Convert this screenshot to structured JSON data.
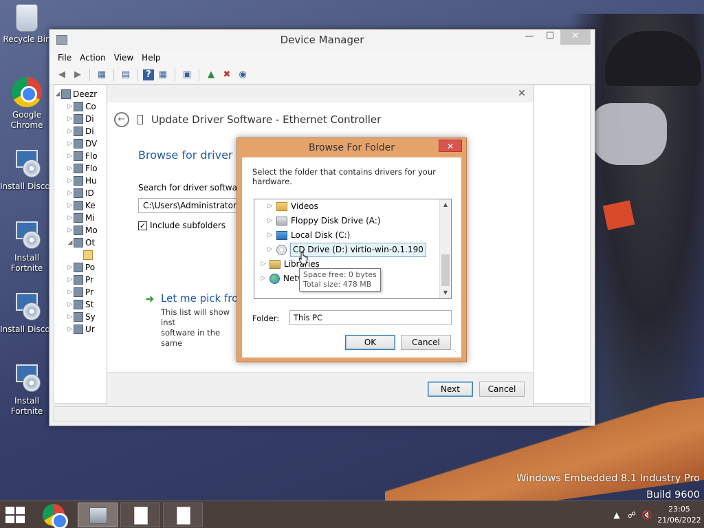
{
  "desktop": {
    "icons": [
      {
        "label": "Recycle Bin"
      },
      {
        "label": "Google Chrome"
      },
      {
        "label": "Install Discord"
      },
      {
        "label": "Install Fortnite"
      },
      {
        "label": "Install Discord"
      },
      {
        "label": "Install Fortnite"
      }
    ],
    "watermark": {
      "line1": "Windows Embedded 8.1 Industry Pro",
      "line2": "Build 9600"
    }
  },
  "device_manager": {
    "title": "Device Manager",
    "menu": [
      "File",
      "Action",
      "View",
      "Help"
    ],
    "tree": {
      "root": "Deezr",
      "items": [
        "Co",
        "Di",
        "Di",
        "DV",
        "Flo",
        "Flo",
        "Hu",
        "ID",
        "Ke",
        "Mi",
        "Mo",
        "Ot",
        "",
        "Po",
        "Pr",
        "Pr",
        "St",
        "Sy",
        "Ur"
      ]
    }
  },
  "wizard": {
    "header": "Update Driver Software - Ethernet Controller",
    "heading": "Browse for driver sof",
    "search_label": "Search for driver software in",
    "path_value": "C:\\Users\\Administrator\\Do",
    "include_subfolders": "Include subfolders",
    "pick_title": "Let me pick from",
    "pick_desc_1": "This list will show inst",
    "pick_desc_2": "software in the same",
    "next": "Next",
    "cancel": "Cancel"
  },
  "browse_dialog": {
    "title": "Browse For Folder",
    "description": "Select the folder that contains drivers for your hardware.",
    "tree": [
      {
        "label": "Videos",
        "icon": "folder-icon"
      },
      {
        "label": "Floppy Disk Drive (A:)",
        "icon": "floppy-drive-icon"
      },
      {
        "label": "Local Disk (C:)",
        "icon": "local-disk-icon"
      },
      {
        "label": "CD Drive (D:) virtio-win-0.1.190",
        "icon": "cd-drive-icon",
        "selected": true
      },
      {
        "label": "Libraries",
        "icon": "libraries-icon"
      },
      {
        "label": "Network",
        "icon": "network-icon"
      }
    ],
    "tooltip": {
      "line1": "Space free: 0 bytes",
      "line2": "Total size: 478 MB"
    },
    "folder_label": "Folder:",
    "folder_value": "This PC",
    "ok": "OK",
    "cancel": "Cancel"
  },
  "taskbar": {
    "clock_time": "23:05",
    "clock_date": "21/06/2022"
  }
}
